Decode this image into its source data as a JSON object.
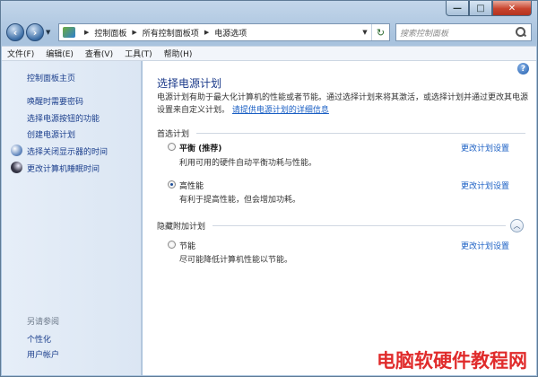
{
  "window": {
    "caption": {
      "minimize": "—",
      "maximize": "□",
      "close": "✕"
    }
  },
  "address": {
    "back_icon": "back-arrow-icon",
    "forward_icon": "forward-arrow-icon",
    "crumbs": [
      "控制面板",
      "所有控制面板项",
      "电源选项"
    ],
    "search_placeholder": "搜索控制面板"
  },
  "menubar": {
    "items": [
      "文件(F)",
      "编辑(E)",
      "查看(V)",
      "工具(T)",
      "帮助(H)"
    ]
  },
  "sidebar": {
    "home": "控制面板主页",
    "links": [
      "唤醒时需要密码",
      "选择电源按钮的功能",
      "创建电源计划",
      "选择关闭显示器的时间",
      "更改计算机睡眠时间"
    ],
    "see_also_title": "另请参阅",
    "see_also": [
      "个性化",
      "用户帐户"
    ]
  },
  "main": {
    "title": "选择电源计划",
    "description": "电源计划有助于最大化计算机的性能或者节能。通过选择计划来将其激活，或选择计划并通过更改其电源设置来自定义计划。",
    "description_link": "请提供电源计划的详细信息",
    "preferred_header": "首选计划",
    "hidden_header": "隐藏附加计划",
    "plans": [
      {
        "name": "平衡 (推荐)",
        "desc": "利用可用的硬件自动平衡功耗与性能。",
        "link": "更改计划设置",
        "selected": false
      },
      {
        "name": "高性能",
        "desc": "有利于提高性能，但会增加功耗。",
        "link": "更改计划设置",
        "selected": true
      },
      {
        "name": "节能",
        "desc": "尽可能降低计算机性能以节能。",
        "link": "更改计划设置",
        "selected": false
      }
    ]
  },
  "watermark": "电脑软硬件教程网"
}
